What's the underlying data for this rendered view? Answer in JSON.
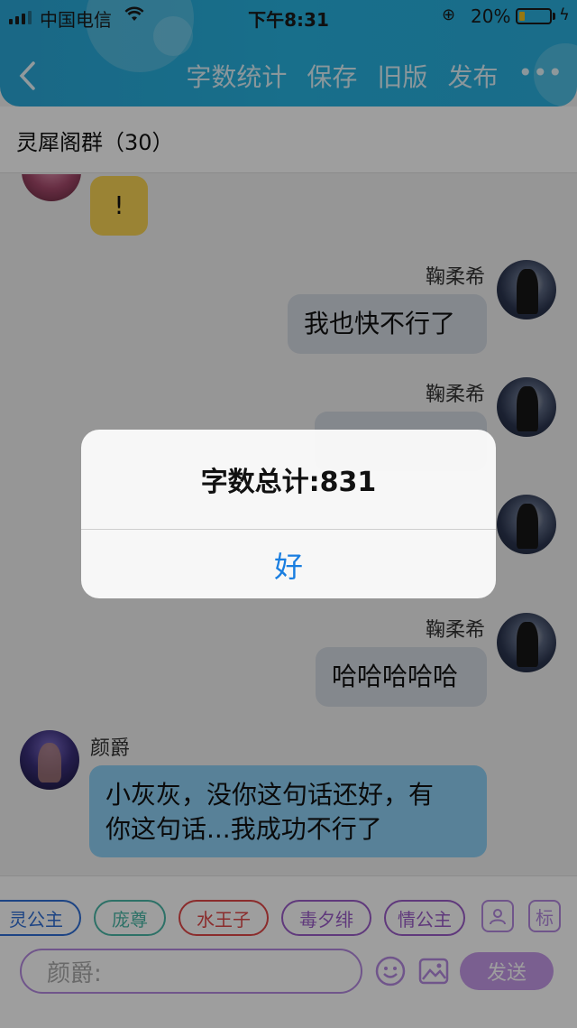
{
  "status_bar": {
    "carrier": "中国电信",
    "time": "下午8:31",
    "battery_percent": "20%",
    "battery_level": 0.2
  },
  "nav": {
    "actions": [
      "字数统计",
      "保存",
      "旧版",
      "发布"
    ],
    "more": "•••"
  },
  "group": {
    "title": "灵犀阁群（30）"
  },
  "messages": [
    {
      "sender": "",
      "text": "!",
      "side": "left"
    },
    {
      "sender": "鞠柔希",
      "text": "我也快不行了",
      "side": "right"
    },
    {
      "sender": "鞠柔希",
      "text": "",
      "side": "right"
    },
    {
      "sender": "",
      "text": "",
      "side": "right"
    },
    {
      "sender": "鞠柔希",
      "text": "哈哈哈哈哈",
      "side": "right"
    },
    {
      "sender": "颜爵",
      "text_line1": "小灰灰，没你这句话还好，有",
      "text_line2": "你这句话...我成功不行了",
      "side": "left"
    }
  ],
  "tags": [
    {
      "label": "灵公主",
      "color": "#2f6fd6"
    },
    {
      "label": "庞尊",
      "color": "#49b7a6"
    },
    {
      "label": "水王子",
      "color": "#e04848"
    },
    {
      "label": "毒夕绯",
      "color": "#9b5cc9"
    },
    {
      "label": "情公主",
      "color": "#9b5cc9"
    }
  ],
  "tag_buttons": {
    "person": "人",
    "label": "标"
  },
  "composer": {
    "placeholder": "颜爵:",
    "send": "发送"
  },
  "alert": {
    "message": "字数总计:831",
    "button": "好"
  }
}
